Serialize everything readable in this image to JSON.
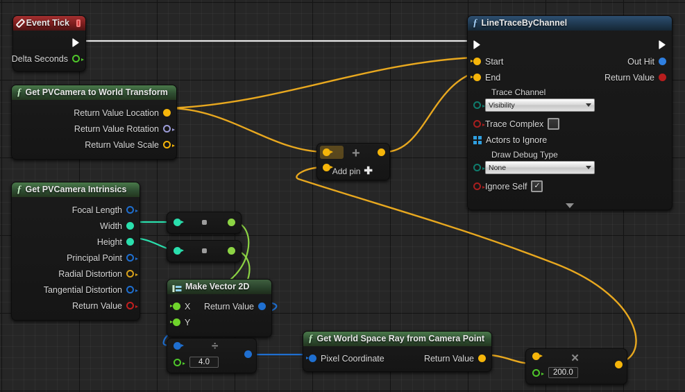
{
  "app": {
    "title": "Unreal Engine Blueprint Event Graph"
  },
  "colors": {
    "exec_white": "#ffffff",
    "vector_gold": "#f5b50a",
    "float_green": "#8cd444",
    "int_teal": "#2adfad",
    "bool_red": "#a81f1f",
    "struct_blue": "#1f6fd0",
    "rotator_lavender": "#9c9cd8",
    "name_teal": "#0f7c6d",
    "object_blue": "#2f9fe0",
    "background": "#262626"
  },
  "nodes": {
    "event_tick": {
      "title": "Event Tick",
      "icon": "event-diamond-icon",
      "badge": "event-stop-icon",
      "outputs": [
        {
          "label": "",
          "type": "exec",
          "name": "exec-out"
        },
        {
          "label": "Delta Seconds",
          "type": "float",
          "name": "delta-seconds"
        }
      ]
    },
    "camera_transform": {
      "title": "Get PVCamera to World Transform",
      "icon": "function-icon",
      "outputs": [
        {
          "label": "Return Value Location",
          "type": "vector",
          "filled": true
        },
        {
          "label": "Return Value Rotation",
          "type": "rotator",
          "filled": false
        },
        {
          "label": "Return Value Scale",
          "type": "vector",
          "filled": false
        }
      ]
    },
    "camera_intrinsics": {
      "title": "Get PVCamera Intrinsics",
      "icon": "function-icon",
      "outputs": [
        {
          "label": "Focal Length",
          "type": "struct",
          "filled": false
        },
        {
          "label": "Width",
          "type": "int",
          "filled": true
        },
        {
          "label": "Height",
          "type": "int",
          "filled": true
        },
        {
          "label": "Principal Point",
          "type": "struct",
          "filled": false
        },
        {
          "label": "Radial Distortion",
          "type": "vector",
          "filled": false
        },
        {
          "label": "Tangential Distortion",
          "type": "struct",
          "filled": false
        },
        {
          "label": "Return Value",
          "type": "bool",
          "filled": false
        }
      ]
    },
    "line_trace": {
      "title": "LineTraceByChannel",
      "icon": "function-icon",
      "inputs": [
        {
          "label": "Start",
          "type": "vector"
        },
        {
          "label": "End",
          "type": "vector"
        }
      ],
      "outputs": [
        {
          "label": "Out Hit",
          "type": "object"
        },
        {
          "label": "Return Value",
          "type": "bool"
        }
      ],
      "trace_channel_label": "Trace Channel",
      "trace_channel_value": "Visibility",
      "trace_complex_label": "Trace Complex",
      "trace_complex_checked": false,
      "actors_to_ignore_label": "Actors to Ignore",
      "draw_debug_label": "Draw Debug Type",
      "draw_debug_value": "None",
      "ignore_self_label": "Ignore Self",
      "ignore_self_checked": true,
      "collapse_icon": "chevron-down-icon"
    },
    "add_node": {
      "operator": "+",
      "add_pin_label": "Add pin",
      "add_pin_icon": "plus-icon"
    },
    "conv_width": {
      "type": "conversion",
      "glyph": "conversion-dot-icon"
    },
    "conv_height": {
      "type": "conversion",
      "glyph": "conversion-dot-icon"
    },
    "make_vector2d": {
      "title": "Make Vector 2D",
      "icon": "make-struct-icon",
      "inputs": [
        {
          "label": "X",
          "type": "float"
        },
        {
          "label": "Y",
          "type": "float"
        }
      ],
      "outputs": [
        {
          "label": "Return Value",
          "type": "struct"
        }
      ]
    },
    "divide_node": {
      "operator": "÷",
      "value": "4.0"
    },
    "world_ray": {
      "title": "Get World Space Ray from Camera Point",
      "icon": "function-icon",
      "inputs": [
        {
          "label": "Pixel Coordinate",
          "type": "struct"
        }
      ],
      "outputs": [
        {
          "label": "Return Value",
          "type": "vector"
        }
      ]
    },
    "multiply_node": {
      "operator": "×",
      "value": "200.0"
    }
  }
}
